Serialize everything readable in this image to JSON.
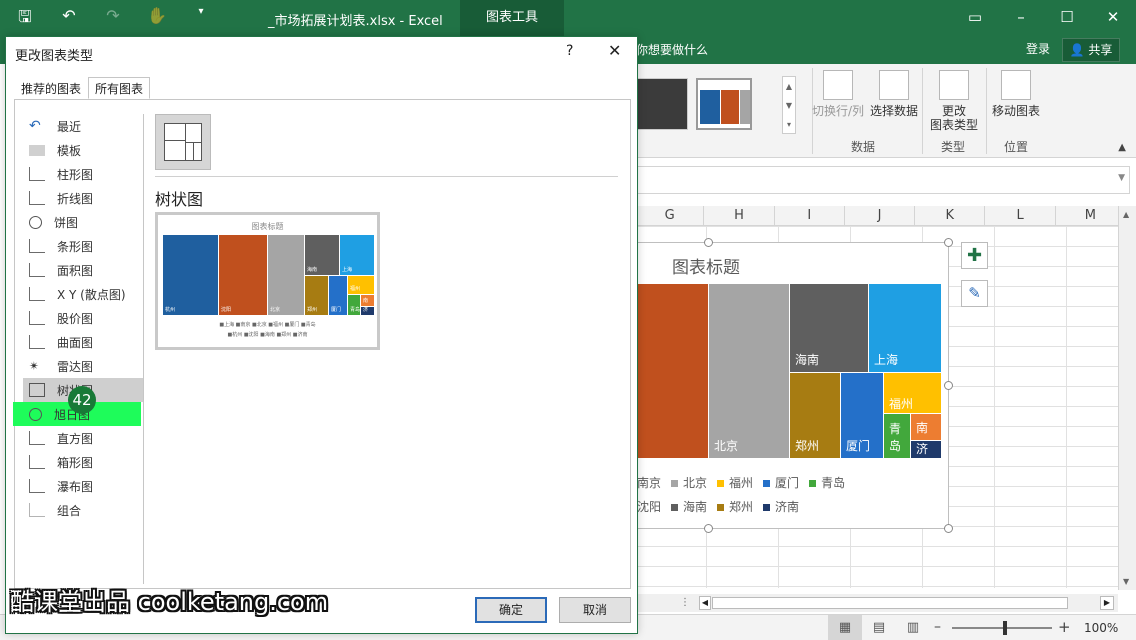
{
  "app": {
    "window_title": "_市场拓展计划表.xlsx - Excel",
    "context_tab": "图表工具",
    "tell_me": "你想要做什么",
    "sign_in": "登录",
    "share": "共享"
  },
  "ribbon": {
    "switch_row_col": "切换行/列",
    "select_data": "选择数据",
    "change_type_1": "更改",
    "change_type_2": "图表类型",
    "move_chart": "移动图表",
    "group_data": "数据",
    "group_type": "类型",
    "group_location": "位置"
  },
  "columns": [
    "G",
    "H",
    "I",
    "J",
    "K",
    "L",
    "M"
  ],
  "chart": {
    "title": "图表标题",
    "tiles": [
      "北京",
      "海南",
      "上海",
      "郑州",
      "厦门",
      "福州",
      "青岛",
      "南",
      "济"
    ],
    "legend_row1": [
      "南京",
      "北京",
      "福州",
      "厦门",
      "青岛"
    ],
    "legend_row2": [
      "沈阳",
      "海南",
      "郑州",
      "济南"
    ],
    "colors": {
      "orange": "#c0501e",
      "gray": "#a5a5a5",
      "darkgray": "#5f5f5f",
      "blue": "#1f9fe3",
      "gold": "#a77c12",
      "mblue": "#2470c9",
      "yellow": "#ffc000",
      "green": "#42a83c",
      "lorange": "#ed7d31",
      "navy": "#1f3a6b"
    }
  },
  "zoom": "100%",
  "dialog": {
    "title": "更改图表类型",
    "help": "?",
    "close": "✕",
    "tabs": [
      "推荐的图表",
      "所有图表"
    ],
    "types": [
      "最近",
      "模板",
      "柱形图",
      "折线图",
      "饼图",
      "条形图",
      "面积图",
      "X Y (散点图)",
      "股价图",
      "曲面图",
      "雷达图",
      "树状图",
      "旭日图",
      "直方图",
      "箱形图",
      "瀑布图",
      "组合"
    ],
    "selected_type": "树状图",
    "badge": "42",
    "preview_title": "图表标题",
    "preview_tiles": [
      "杭州",
      "沈阳",
      "北京",
      "海南",
      "上海",
      "郑州",
      "厦门",
      "福州",
      "青岛",
      "南",
      "济"
    ],
    "preview_legend_1": "■上海 ■南京 ■北京 ■福州 ■厦门 ■青岛",
    "preview_legend_2": "■杭州 ■沈阳 ■海南 ■郑州 ■济南",
    "ok": "确定",
    "cancel": "取消"
  },
  "watermark": "酷课堂出品 coolketang.com"
}
